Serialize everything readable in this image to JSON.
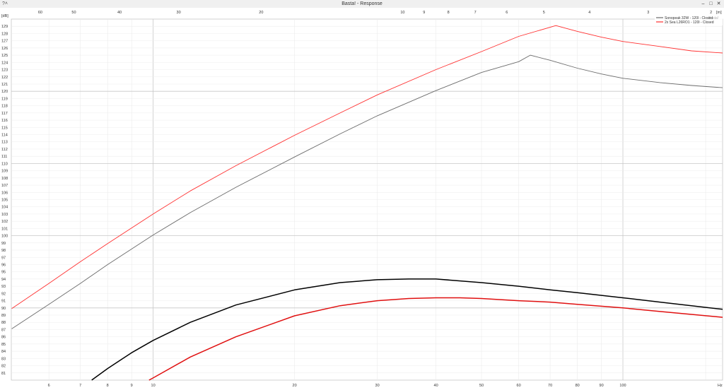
{
  "window": {
    "title": "Basta! - Response",
    "left_label": "?˄",
    "buttons": {
      "minimize": "–",
      "restore": "□",
      "close": "✕"
    }
  },
  "chart_data": {
    "type": "line",
    "x_scale": "log",
    "xlim": [
      4.99,
      163
    ],
    "ylim": [
      80,
      130
    ],
    "xlabel": "Hz",
    "ylabel": "[dB]",
    "grid": true,
    "legend_position": "top-right",
    "legend_extra": "Basta!",
    "x_ticks": [
      {
        "value": 6,
        "label": "6"
      },
      {
        "value": 7,
        "label": "7"
      },
      {
        "value": 8,
        "label": "8"
      },
      {
        "value": 9,
        "label": "9"
      },
      {
        "value": 10,
        "label": "10"
      },
      {
        "value": 20,
        "label": "20"
      },
      {
        "value": 30,
        "label": "30"
      },
      {
        "value": 40,
        "label": "40"
      },
      {
        "value": 50,
        "label": "50"
      },
      {
        "value": 60,
        "label": "60"
      },
      {
        "value": 70,
        "label": "70"
      },
      {
        "value": 80,
        "label": "80"
      },
      {
        "value": 90,
        "label": "90"
      },
      {
        "value": 100,
        "label": "100"
      }
    ],
    "top_ticks": [
      {
        "value": 5.75,
        "label": "60"
      },
      {
        "value": 6.78,
        "label": "50"
      },
      {
        "value": 8.48,
        "label": "40"
      },
      {
        "value": 11.33,
        "label": "30"
      },
      {
        "value": 16.98,
        "label": "20"
      },
      {
        "value": 33.96,
        "label": "10"
      },
      {
        "value": 37.73,
        "label": "9"
      },
      {
        "value": 42.5,
        "label": "8"
      },
      {
        "value": 48.5,
        "label": "7"
      },
      {
        "value": 56.6,
        "label": "6"
      },
      {
        "value": 67.9,
        "label": "5"
      },
      {
        "value": 84.9,
        "label": "4"
      },
      {
        "value": 113.2,
        "label": "3"
      },
      {
        "value": 154,
        "label": "2"
      }
    ],
    "top_axis_unit": "[m]",
    "series": [
      {
        "name": "Sonopeak 32W - 120l - Closed",
        "color": "#6b6b6b",
        "width": 0.9,
        "x": [
          5,
          6,
          7,
          8,
          10,
          12,
          15,
          20,
          25,
          30,
          40,
          50,
          60,
          63.5,
          70,
          80,
          90,
          100,
          120,
          140,
          163
        ],
        "y": [
          87.1,
          90.5,
          93.4,
          96.0,
          100.1,
          103.2,
          106.7,
          110.9,
          114.1,
          116.6,
          120.1,
          122.6,
          124.1,
          125.0,
          124.3,
          123.2,
          122.4,
          121.8,
          121.2,
          120.8,
          120.5
        ]
      },
      {
        "name": "2x Sea L26RO1 - 120l - Closed",
        "color": "#ff3030",
        "width": 0.9,
        "x": [
          5,
          6,
          7,
          8,
          10,
          12,
          15,
          20,
          25,
          30,
          40,
          50,
          60,
          72,
          80,
          90,
          100,
          120,
          140,
          163
        ],
        "y": [
          89.9,
          93.4,
          96.4,
          98.9,
          103.0,
          106.2,
          109.7,
          113.9,
          117.0,
          119.5,
          123.0,
          125.5,
          127.6,
          129.1,
          128.3,
          127.5,
          126.9,
          126.2,
          125.6,
          125.3
        ]
      },
      {
        "name": "",
        "color": "#000000",
        "width": 1.5,
        "x": [
          7.4,
          8,
          9,
          10,
          12,
          15,
          20,
          25,
          30,
          35,
          40,
          50,
          60,
          70,
          80,
          100,
          120,
          140,
          163
        ],
        "y": [
          80.0,
          81.6,
          83.8,
          85.5,
          88.0,
          90.4,
          92.5,
          93.5,
          93.9,
          94.0,
          94.0,
          93.5,
          93.0,
          92.5,
          92.1,
          91.4,
          90.8,
          90.3,
          89.8
        ]
      },
      {
        "name": "",
        "color": "#e01010",
        "width": 1.5,
        "x": [
          9.8,
          10,
          12,
          15,
          20,
          25,
          30,
          35,
          40,
          45,
          50,
          60,
          70,
          80,
          100,
          120,
          140,
          163
        ],
        "y": [
          80.0,
          80.3,
          83.2,
          86.0,
          88.9,
          90.3,
          91.0,
          91.3,
          91.4,
          91.4,
          91.3,
          91.0,
          90.8,
          90.5,
          90.0,
          89.5,
          89.1,
          88.7
        ]
      }
    ]
  }
}
